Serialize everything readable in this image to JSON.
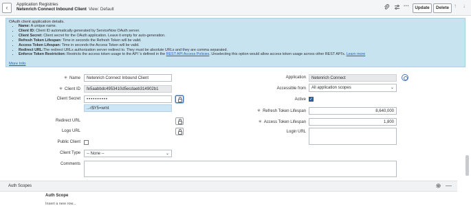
{
  "header": {
    "breadcrumb": "Application Registries",
    "title": "Netenrich Connect Inbound Client",
    "view": "View: Default",
    "back_icon": "chevron-left-icon",
    "icons": [
      "paperclip-icon",
      "sliders-icon",
      "more-icon"
    ],
    "update_label": "Update",
    "delete_label": "Delete",
    "nav_icons": [
      "arrow-up-icon",
      "arrow-down-icon"
    ]
  },
  "info": {
    "intro": "OAuth client application details.",
    "items": [
      {
        "term": "Name:",
        "desc": " A unique name."
      },
      {
        "term": "Client ID:",
        "desc": " Client ID automatically generated by ServiceNow OAuth server."
      },
      {
        "term": "Client Secret:",
        "desc": " Client secret for the OAuth application. Leave it empty for auto-generation."
      },
      {
        "term": "Refresh Token Lifespan:",
        "desc": " Time in seconds the Refresh Token will be valid."
      },
      {
        "term": "Access Token Lifespan:",
        "desc": " Time in seconds the Access Token will be valid."
      },
      {
        "term": "Redirect URL:",
        "desc": "The redirect URLs authorization server redirect to. They must be absolute URLs and they are comma separated."
      }
    ],
    "enforce_term": "Enforce Token Restriction:",
    "enforce_desc": " Restricts the access token usage to the API 's defined in the ",
    "enforce_link": "REST API Access Policies",
    "enforce_desc2": ". Unselecting this option would allow access token usage across other REST API's. ",
    "enforce_learn": "Learn more",
    "more_info": "More Info"
  },
  "form": {
    "name_label": "Name",
    "name_value": "Netenrich Connect Inbound Client",
    "client_id_label": "Client ID",
    "client_id_value": "fe5aabbdc4953410d5ecdaeb314902b1",
    "client_secret_label": "Client Secret",
    "client_secret_value": "••••••••••",
    "client_secret_revealed": "..-r$Y5=wmt",
    "redirect_url_label": "Redirect URL",
    "logo_url_label": "Logo URL",
    "public_client_label": "Public Client",
    "public_client_checked": false,
    "client_type_label": "Client Type",
    "client_type_value": "-- None --",
    "comments_label": "Comments",
    "application_label": "Application",
    "application_value": "Netenrich Connect",
    "accessible_from_label": "Accessible from",
    "accessible_from_value": "All application scopes",
    "active_label": "Active",
    "active_checked": true,
    "refresh_label": "Refresh Token Lifespan",
    "refresh_value": "8,640,000",
    "access_label": "Access Token Lifespan",
    "access_value": "1,800",
    "login_url_label": "Login URL"
  },
  "related": {
    "tab_label": "Auth Scopes",
    "column": "Auth Scope",
    "row_text": "Insert a new row..."
  }
}
